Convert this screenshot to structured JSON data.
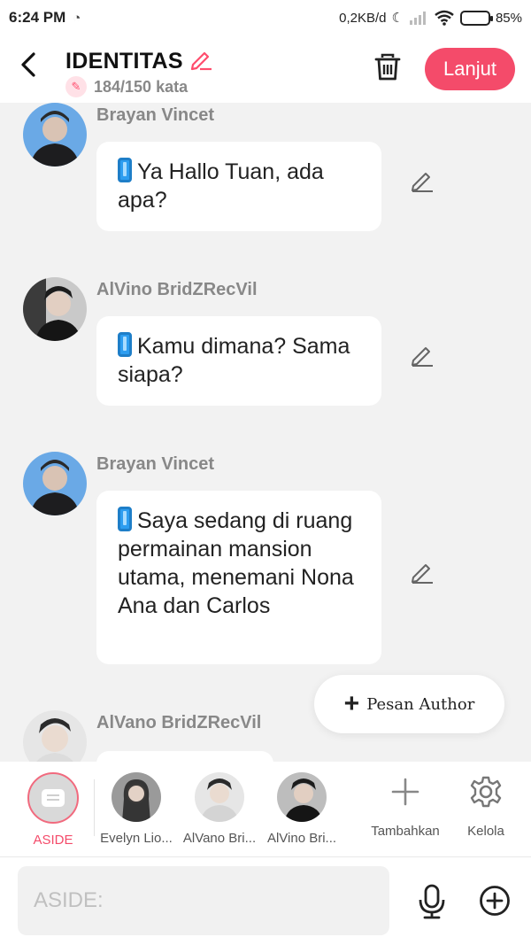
{
  "status_bar": {
    "time": "6:24 PM",
    "network_speed": "0,2KB/d",
    "battery_percent": "85%",
    "battery_level": 0.85
  },
  "header": {
    "title": "IDENTITAS",
    "word_count": "184/150 kata",
    "next_label": "Lanjut",
    "accent_color": "#f44b6a"
  },
  "messages": [
    {
      "sender": "Brayan Vincet",
      "text": "Ya Hallo Tuan, ada apa?",
      "icon": "phone-icon"
    },
    {
      "sender": "AlVino BridZRecVil",
      "text": "Kamu dimana? Sama siapa?",
      "icon": "phone-icon"
    },
    {
      "sender": "Brayan Vincet",
      "text": "Saya sedang di ruang permainan mansion utama, menemani Nona Ana dan Carlos",
      "icon": "phone-icon"
    },
    {
      "sender": "AlVano BridZRecVil",
      "text": "",
      "icon": ""
    }
  ],
  "author_button": {
    "label": "Pesan Author"
  },
  "characters": [
    {
      "label": "ASIDE"
    },
    {
      "label": "Evelyn Lio..."
    },
    {
      "label": "AlVano Bri..."
    },
    {
      "label": "AlVino Bri..."
    }
  ],
  "tools": [
    {
      "label": "Tambahkan",
      "icon": "plus-icon"
    },
    {
      "label": "Kelola",
      "icon": "gear-icon"
    }
  ],
  "input": {
    "placeholder": "ASIDE:"
  }
}
